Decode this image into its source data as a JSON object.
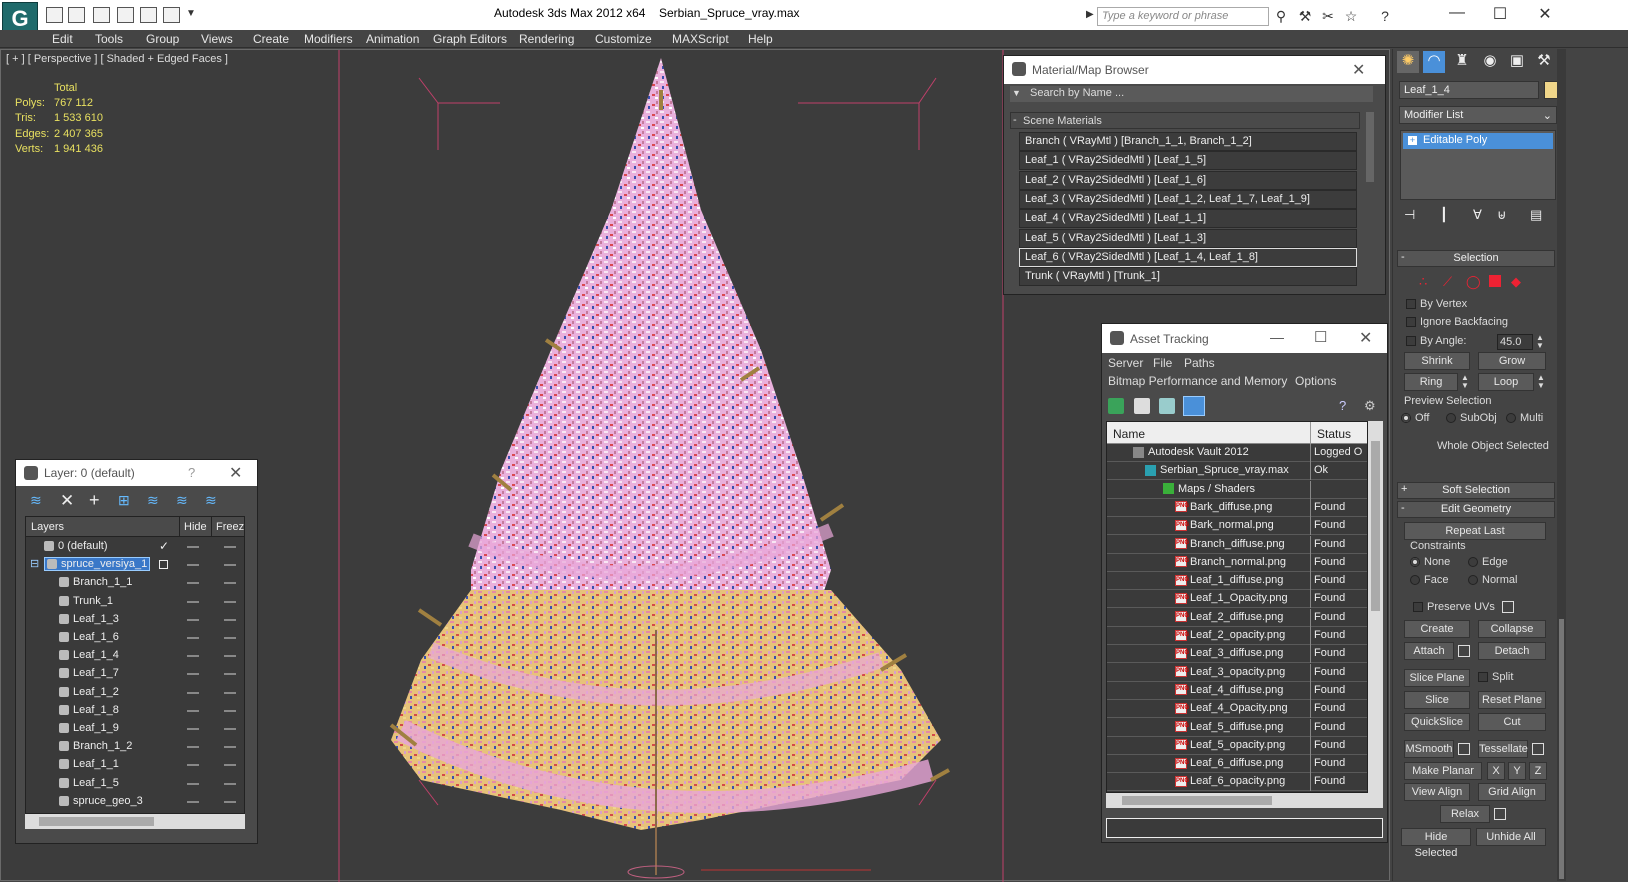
{
  "title": {
    "app": "Autodesk 3ds Max  2012 x64",
    "file": "Serbian_Spruce_vray.max",
    "search_placeholder": "Type a keyword or phrase",
    "logo": "G"
  },
  "menu": [
    "Edit",
    "Tools",
    "Group",
    "Views",
    "Create",
    "Modifiers",
    "Animation",
    "Graph Editors",
    "Rendering",
    "Customize",
    "MAXScript",
    "Help"
  ],
  "viewport": {
    "label": "[ + ] [ Perspective ] [ Shaded + Edged Faces ]",
    "stats_header": "Total",
    "stats": [
      {
        "label": "Polys:",
        "value": "767 112"
      },
      {
        "label": "Tris:",
        "value": "1 533 610"
      },
      {
        "label": "Edges:",
        "value": "2 407 365"
      },
      {
        "label": "Verts:",
        "value": "1 941 436"
      }
    ]
  },
  "material_browser": {
    "title": "Material/Map Browser",
    "search": "Search by Name ...",
    "section": "Scene Materials",
    "items": [
      "Branch  ( VRayMtl ) [Branch_1_1, Branch_1_2]",
      "Leaf_1  ( VRay2SidedMtl ) [Leaf_1_5]",
      "Leaf_2  ( VRay2SidedMtl ) [Leaf_1_6]",
      "Leaf_3  ( VRay2SidedMtl ) [Leaf_1_2, Leaf_1_7, Leaf_1_9]",
      "Leaf_4  ( VRay2SidedMtl ) [Leaf_1_1]",
      "Leaf_5  ( VRay2SidedMtl ) [Leaf_1_3]",
      "Leaf_6  ( VRay2SidedMtl ) [Leaf_1_4, Leaf_1_8]",
      "Trunk  ( VRayMtl ) [Trunk_1]"
    ],
    "selected_index": 6
  },
  "asset_tracking": {
    "title": "Asset Tracking",
    "menu1": [
      "Server",
      "File",
      "Paths"
    ],
    "menu2": [
      "Bitmap Performance and Memory",
      "Options"
    ],
    "col_name": "Name",
    "col_status": "Status",
    "rows": [
      {
        "name": "Autodesk Vault 2012",
        "status": "Logged O",
        "level": 1
      },
      {
        "name": "Serbian_Spruce_vray.max",
        "status": "Ok",
        "level": 2
      },
      {
        "name": "Maps / Shaders",
        "status": "",
        "level": 3
      },
      {
        "name": "Bark_diffuse.png",
        "status": "Found",
        "level": 4
      },
      {
        "name": "Bark_normal.png",
        "status": "Found",
        "level": 4
      },
      {
        "name": "Branch_diffuse.png",
        "status": "Found",
        "level": 4
      },
      {
        "name": "Branch_normal.png",
        "status": "Found",
        "level": 4
      },
      {
        "name": "Leaf_1_diffuse.png",
        "status": "Found",
        "level": 4
      },
      {
        "name": "Leaf_1_Opacity.png",
        "status": "Found",
        "level": 4
      },
      {
        "name": "Leaf_2_diffuse.png",
        "status": "Found",
        "level": 4
      },
      {
        "name": "Leaf_2_opacity.png",
        "status": "Found",
        "level": 4
      },
      {
        "name": "Leaf_3_diffuse.png",
        "status": "Found",
        "level": 4
      },
      {
        "name": "Leaf_3_opacity.png",
        "status": "Found",
        "level": 4
      },
      {
        "name": "Leaf_4_diffuse.png",
        "status": "Found",
        "level": 4
      },
      {
        "name": "Leaf_4_Opacity.png",
        "status": "Found",
        "level": 4
      },
      {
        "name": "Leaf_5_diffuse.png",
        "status": "Found",
        "level": 4
      },
      {
        "name": "Leaf_5_opacity.png",
        "status": "Found",
        "level": 4
      },
      {
        "name": "Leaf_6_diffuse.png",
        "status": "Found",
        "level": 4
      },
      {
        "name": "Leaf_6_opacity.png",
        "status": "Found",
        "level": 4
      }
    ],
    "png_badge": "PNG"
  },
  "layer_window": {
    "title": "Layer: 0 (default)",
    "help": "?",
    "col_layers": "Layers",
    "col_hide": "Hide",
    "col_freeze": "Freeze",
    "rows": [
      {
        "name": "0 (default)",
        "level": 1,
        "selected": false
      },
      {
        "name": "spruce_versiya_1",
        "level": 1,
        "selected": true
      },
      {
        "name": "Branch_1_1",
        "level": 2,
        "selected": false
      },
      {
        "name": "Trunk_1",
        "level": 2,
        "selected": false
      },
      {
        "name": "Leaf_1_3",
        "level": 2,
        "selected": false
      },
      {
        "name": "Leaf_1_6",
        "level": 2,
        "selected": false
      },
      {
        "name": "Leaf_1_4",
        "level": 2,
        "selected": false
      },
      {
        "name": "Leaf_1_7",
        "level": 2,
        "selected": false
      },
      {
        "name": "Leaf_1_2",
        "level": 2,
        "selected": false
      },
      {
        "name": "Leaf_1_8",
        "level": 2,
        "selected": false
      },
      {
        "name": "Leaf_1_9",
        "level": 2,
        "selected": false
      },
      {
        "name": "Branch_1_2",
        "level": 2,
        "selected": false
      },
      {
        "name": "Leaf_1_1",
        "level": 2,
        "selected": false
      },
      {
        "name": "Leaf_1_5",
        "level": 2,
        "selected": false
      },
      {
        "name": "spruce_geo_3",
        "level": 2,
        "selected": false
      }
    ]
  },
  "command_panel": {
    "object_name": "Leaf_1_4",
    "modifier_list": "Modifier List",
    "stack_item": "Editable Poly",
    "selection": {
      "header": "Selection",
      "by_vertex": "By Vertex",
      "ignore_backfacing": "Ignore Backfacing",
      "by_angle": "By Angle:",
      "angle_value": "45.0",
      "shrink": "Shrink",
      "grow": "Grow",
      "ring": "Ring",
      "loop": "Loop",
      "preview": "Preview Selection",
      "off": "Off",
      "subobj": "SubObj",
      "multi": "Multi",
      "status": "Whole Object Selected"
    },
    "soft_selection": "Soft Selection",
    "edit_geometry": {
      "header": "Edit Geometry",
      "repeat_last": "Repeat Last",
      "constraints": "Constraints",
      "none": "None",
      "edge": "Edge",
      "face": "Face",
      "normal": "Normal",
      "preserve_uvs": "Preserve UVs",
      "create": "Create",
      "collapse": "Collapse",
      "attach": "Attach",
      "detach": "Detach",
      "slice_plane": "Slice Plane",
      "split": "Split",
      "slice": "Slice",
      "reset_plane": "Reset Plane",
      "quickslice": "QuickSlice",
      "cut": "Cut",
      "msmooth": "MSmooth",
      "tessellate": "Tessellate",
      "make_planar": "Make Planar",
      "x": "X",
      "y": "Y",
      "z": "Z",
      "view_align": "View Align",
      "grid_align": "Grid Align",
      "relax": "Relax",
      "hide_selected": "Hide Selected",
      "unhide_all": "Unhide All"
    }
  },
  "colors": {
    "accent": "#4a90d9",
    "tree_pink": "#e8a6d8",
    "tree_yellow": "#e6c46a",
    "stats": "#e8e060"
  }
}
